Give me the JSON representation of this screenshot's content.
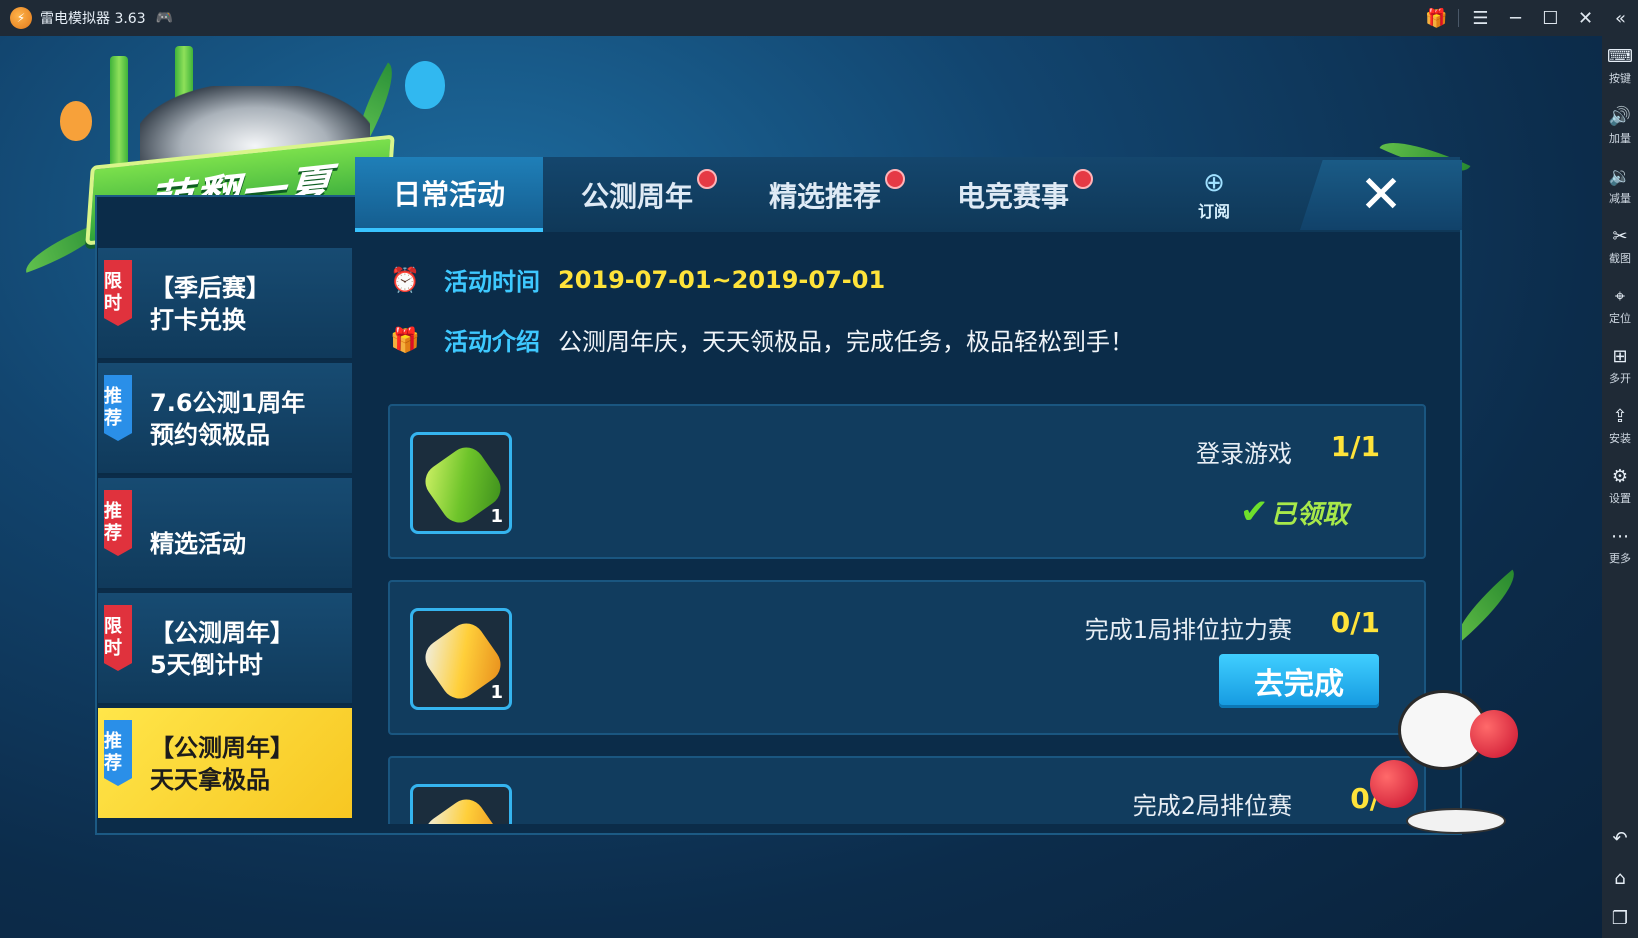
{
  "window": {
    "title": "雷电模拟器 3.63",
    "controls": [
      "gift-icon",
      "menu-icon",
      "minimize-icon",
      "maximize-icon",
      "close-icon",
      "collapse-icon"
    ]
  },
  "sidebar": {
    "items": [
      {
        "label": "按键",
        "icon": "keyboard-icon"
      },
      {
        "label": "加量",
        "icon": "volume-up-icon"
      },
      {
        "label": "减量",
        "icon": "volume-down-icon"
      },
      {
        "label": "截图",
        "icon": "scissors-icon"
      },
      {
        "label": "定位",
        "icon": "location-icon"
      },
      {
        "label": "多开",
        "icon": "multi-instance-icon"
      },
      {
        "label": "安装",
        "icon": "apk-install-icon"
      },
      {
        "label": "设置",
        "icon": "gear-icon"
      },
      {
        "label": "更多",
        "icon": "more-icon"
      }
    ],
    "nav": [
      "back-icon",
      "home-icon",
      "recents-icon"
    ]
  },
  "game": {
    "banner_title": "萌翻一夏",
    "tabs": [
      {
        "label": "日常活动",
        "active": true,
        "badge": false
      },
      {
        "label": "公测周年",
        "active": false,
        "badge": true
      },
      {
        "label": "精选推荐",
        "active": false,
        "badge": true
      },
      {
        "label": "电竞赛事",
        "active": false,
        "badge": true
      }
    ],
    "subscribe_label": "订阅",
    "close_symbol": "✕",
    "activities": [
      {
        "tag": "限时",
        "tag_color": "red",
        "line1": "【季后赛】",
        "line2": "打卡兑换",
        "active": false
      },
      {
        "tag": "推荐",
        "tag_color": "blue",
        "line1": "7.6公测1周年",
        "line2": "预约领极品",
        "active": false
      },
      {
        "tag": "推荐",
        "tag_color": "red",
        "line1": "精选活动",
        "line2": "",
        "active": false
      },
      {
        "tag": "限时",
        "tag_color": "red",
        "line1": "【公测周年】",
        "line2": "5天倒计时",
        "active": false
      },
      {
        "tag": "推荐",
        "tag_color": "blue",
        "line1": "【公测周年】",
        "line2": "天天拿极品",
        "active": true
      }
    ],
    "detail": {
      "time_label": "活动时间",
      "time_value": "2019-07-01~2019-07-01",
      "intro_label": "活动介绍",
      "intro_value": "公测周年庆，天天领极品，完成任务，极品轻松到手！"
    },
    "tasks": [
      {
        "reward_qty": "1",
        "reward_icon": "green-battery-icon",
        "name": "登录游戏",
        "progress": "1/1",
        "status": "已领取"
      },
      {
        "reward_qty": "1",
        "reward_icon": "gold-battery-icon",
        "name": "完成1局排位拉力赛",
        "progress": "0/1",
        "action": "去完成"
      },
      {
        "reward_qty": "",
        "reward_icon": "gold-battery-icon",
        "name": "完成2局排位赛",
        "progress": "0/"
      }
    ]
  }
}
